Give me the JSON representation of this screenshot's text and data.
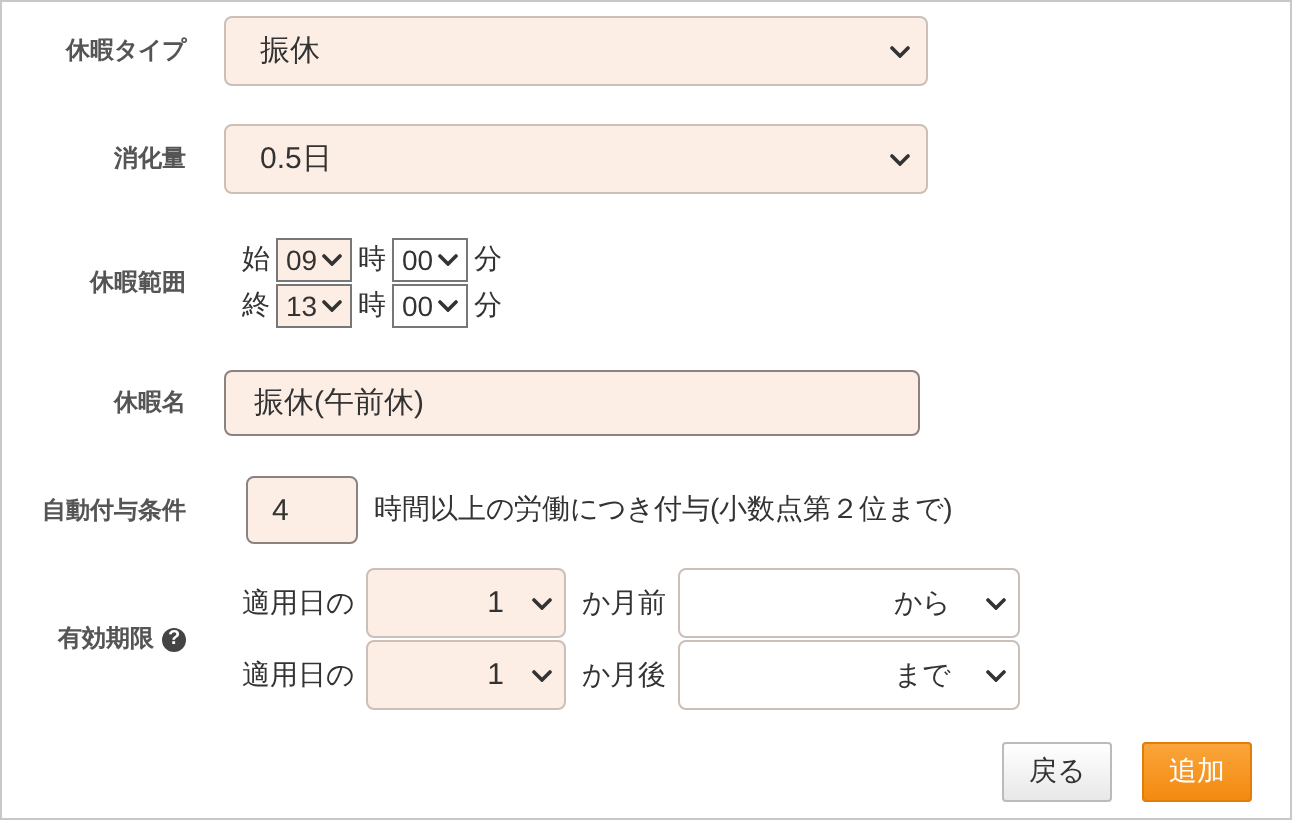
{
  "fields": [
    {
      "kind": "select",
      "label": "休暇タイプ",
      "value": "振休",
      "highlighted": true
    },
    {
      "kind": "select",
      "label": "消化量",
      "value": "0.5日",
      "highlighted": true
    },
    {
      "kind": "time_range",
      "label": "休暇範囲",
      "rows": [
        {
          "prefix": "始",
          "hour": {
            "value": "09",
            "highlighted": true
          },
          "hour_unit": "時",
          "minute": {
            "value": "00",
            "highlighted": false
          },
          "minute_unit": "分"
        },
        {
          "prefix": "終",
          "hour": {
            "value": "13",
            "highlighted": true
          },
          "hour_unit": "時",
          "minute": {
            "value": "00",
            "highlighted": false
          },
          "minute_unit": "分"
        }
      ]
    },
    {
      "kind": "text",
      "label": "休暇名",
      "value": "振休(午前休)",
      "highlighted": true
    },
    {
      "kind": "number_suffix",
      "label": "自動付与条件",
      "value": "4",
      "highlighted": true,
      "suffix": "時間以上の労働につき付与(小数点第２位まで)"
    },
    {
      "kind": "validity",
      "label": "有効期限",
      "help_icon": "?",
      "rows": [
        {
          "prefix": "適用日の",
          "months": {
            "value": "1",
            "highlighted": true
          },
          "unit": "か月前",
          "direction": {
            "value": "から",
            "highlighted": false
          }
        },
        {
          "prefix": "適用日の",
          "months": {
            "value": "1",
            "highlighted": true
          },
          "unit": "か月後",
          "direction": {
            "value": "まで",
            "highlighted": false
          }
        }
      ]
    }
  ],
  "buttons": [
    {
      "label": "戻る",
      "kind": "secondary"
    },
    {
      "label": "追加",
      "kind": "primary"
    }
  ]
}
